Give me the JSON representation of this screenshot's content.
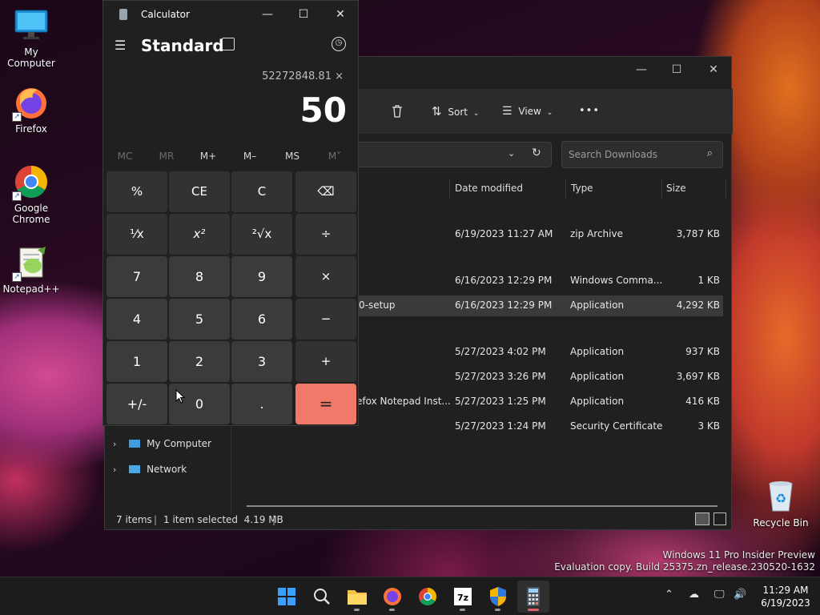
{
  "desktop": {
    "icons": [
      {
        "label": "My Computer",
        "icon": "monitor-icon"
      },
      {
        "label": "Firefox",
        "icon": "firefox-icon"
      },
      {
        "label": "Google Chrome",
        "icon": "chrome-icon"
      },
      {
        "label": "Notepad++",
        "icon": "notepadpp-icon"
      },
      {
        "label": "Recycle Bin",
        "icon": "recycle-bin-icon"
      }
    ],
    "watermark": {
      "line1": "Windows 11 Pro Insider Preview",
      "line2": "Evaluation copy. Build 25375.zn_release.230520-1632"
    }
  },
  "explorer": {
    "toolbar": {
      "sort_label": "Sort",
      "view_label": "View",
      "more_label": "•••"
    },
    "search": {
      "placeholder": "Search Downloads"
    },
    "columns": [
      "Date modified",
      "Type",
      "Size"
    ],
    "rows": [
      {
        "name": "",
        "date": "6/19/2023 11:27 AM",
        "type": "zip Archive",
        "size": "3,787 KB",
        "selected": false
      },
      {
        "name": "",
        "date": "6/16/2023 12:29 PM",
        "type": "Windows Comma...",
        "size": "1 KB",
        "selected": false
      },
      {
        "name": "0-setup",
        "date": "6/16/2023 12:29 PM",
        "type": "Application",
        "size": "4,292 KB",
        "selected": true
      },
      {
        "name": "",
        "date": "5/27/2023 4:02 PM",
        "type": "Application",
        "size": "937 KB",
        "selected": false
      },
      {
        "name": "",
        "date": "5/27/2023 3:26 PM",
        "type": "Application",
        "size": "3,697 KB",
        "selected": false
      },
      {
        "name": "efox Notepad Inst...",
        "date": "5/27/2023 1:25 PM",
        "type": "Application",
        "size": "416 KB",
        "selected": false
      },
      {
        "name": "",
        "date": "5/27/2023 1:24 PM",
        "type": "Security Certificate",
        "size": "3 KB",
        "selected": false
      }
    ],
    "nav": [
      {
        "label": "My Computer"
      },
      {
        "label": "Network"
      }
    ],
    "status": {
      "items": "7 items",
      "selected": "1 item selected  4.19 MB"
    }
  },
  "calculator": {
    "title": "Calculator",
    "mode": "Standard",
    "expression": "52272848.81 ×",
    "display": "50",
    "memory": [
      "MC",
      "MR",
      "M+",
      "M–",
      "MS",
      "M˅"
    ],
    "keys": [
      [
        "%",
        "CE",
        "C",
        "⌫"
      ],
      [
        "¹⁄x",
        "x²",
        "²√x",
        "÷"
      ],
      [
        "7",
        "8",
        "9",
        "×"
      ],
      [
        "4",
        "5",
        "6",
        "−"
      ],
      [
        "1",
        "2",
        "3",
        "+"
      ],
      [
        "+/-",
        "0",
        ".",
        "="
      ]
    ]
  },
  "taskbar": {
    "apps": [
      "start-icon",
      "search-icon",
      "file-explorer-icon",
      "firefox-icon",
      "chrome-icon",
      "7zip-icon",
      "shield-icon",
      "calculator-icon"
    ],
    "clock_time": "11:29 AM",
    "clock_date": "6/19/2023"
  }
}
